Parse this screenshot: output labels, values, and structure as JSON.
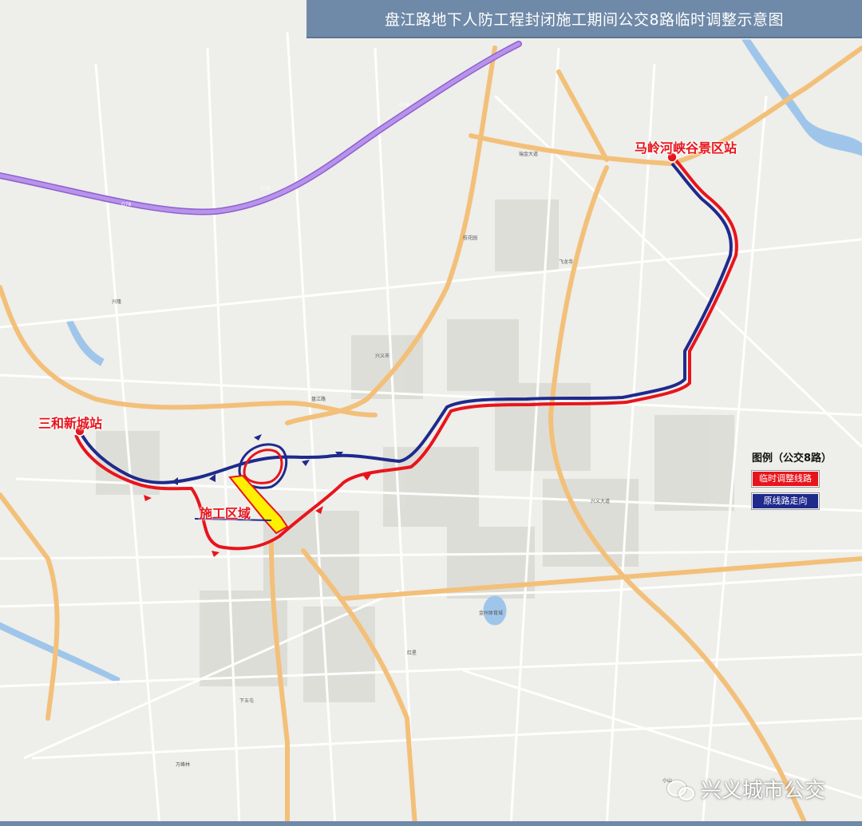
{
  "title": "盘江路地下人防工程封闭施工期间公交8路临时调整示意图",
  "stations": {
    "west": "三和新城站",
    "northeast": "马岭河峡谷景区站"
  },
  "construction_zone": "施工区域",
  "legend": {
    "title": "图例（公交8路）",
    "items": [
      {
        "label": "临时调整线路",
        "color": "#e8141c"
      },
      {
        "label": "原线路走向",
        "color": "#1f2a8c"
      }
    ]
  },
  "watermark": "兴义城市公交",
  "colors": {
    "temporary_route": "#e8141c",
    "original_route": "#1f2a8c",
    "construction_area": "#ffef00",
    "highway": "#a97be0",
    "main_road": "#f3c07a",
    "water": "#9fc6ea",
    "title_bar": "#6f8aa8"
  },
  "map_labels": {
    "highway_g78": "G78",
    "road_panjiang": "盘江路",
    "road_ruijin": "瑞金大道",
    "road_xingye": "兴义大道",
    "place_xingyi_city": "兴义市",
    "place_xiawutun": "下五屯",
    "place_xinglong": "兴隆",
    "place_feilong": "飞龙寺",
    "place_jinzhou": "金州体育城",
    "place_wanfeng": "万峰林",
    "place_xiaoshan": "小山",
    "place_hongxing": "红星",
    "place_guihua": "桂花园"
  }
}
